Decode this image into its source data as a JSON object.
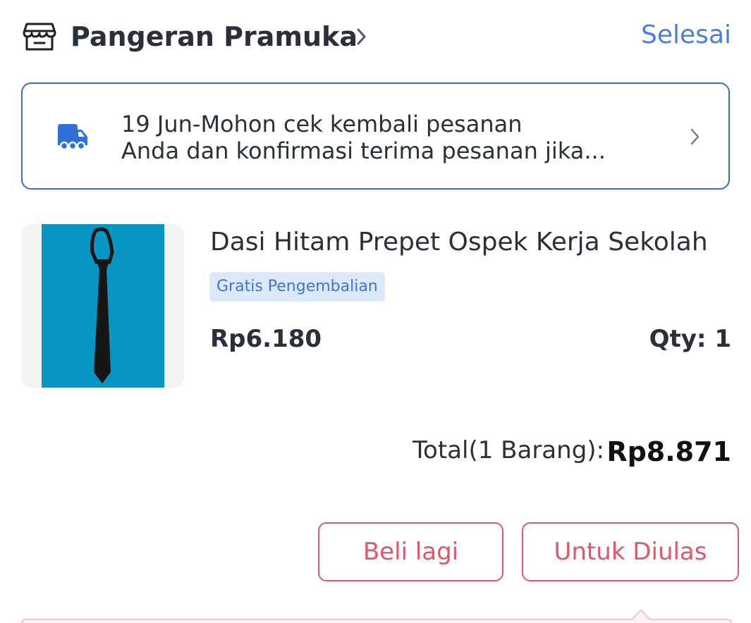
{
  "header": {
    "store_name": "Pangeran Pramuka",
    "status": "Selesai",
    "store_icon": "store-icon",
    "chevron_icon": "chevron-right-icon"
  },
  "notice": {
    "line1": "19 Jun-Mohon cek kembali pesanan",
    "line2": "Anda dan konfirmasi terima pesanan jika...",
    "icon": "truck-icon",
    "accent": "#3c6fc4"
  },
  "product": {
    "name": "Dasi Hitam Prepet Ospek Kerja Sekolah",
    "badge": "Gratis Pengembalian",
    "price": "Rp6.180",
    "qty": "Qty: 1"
  },
  "total": {
    "label": "Total(1 Barang):",
    "value": "Rp8.871"
  },
  "actions": {
    "buy_again": "Beli lagi",
    "review": "Untuk Diulas",
    "accent": "#e0566a"
  }
}
